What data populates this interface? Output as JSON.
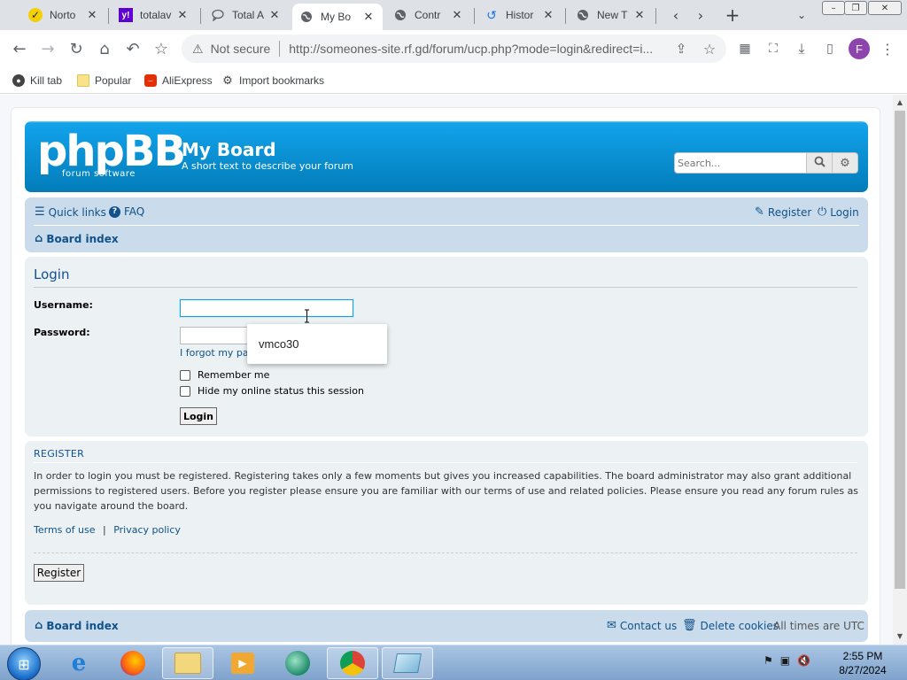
{
  "browser": {
    "tabs": [
      {
        "title": "Norto",
        "icon": "norton-icon",
        "active": false
      },
      {
        "title": "totalav",
        "icon": "yahoo-icon",
        "active": false
      },
      {
        "title": "Total A",
        "icon": "chat-bubble-icon",
        "active": false
      },
      {
        "title": "My Bo",
        "icon": "globe-icon",
        "active": true
      },
      {
        "title": "Contr",
        "icon": "globe-icon",
        "active": false
      },
      {
        "title": "Histor",
        "icon": "history-icon",
        "active": false
      },
      {
        "title": "New T",
        "icon": "globe-icon",
        "active": false
      }
    ],
    "omnibox": {
      "security_label": "Not secure",
      "url": "http://someones-site.rf.gd/forum/ucp.php?mode=login&redirect=i..."
    },
    "profile_initial": "F",
    "bookmarks": [
      {
        "label": "Kill tab",
        "icon": "kill-tab-icon"
      },
      {
        "label": "Popular",
        "icon": "folder-icon"
      },
      {
        "label": "AliExpress",
        "icon": "aliexpress-icon"
      },
      {
        "label": "Import bookmarks",
        "icon": "gear-icon"
      }
    ]
  },
  "forum": {
    "logo_text": "phpBB",
    "logo_subtext": "forum  software",
    "site_name": "My Board",
    "site_description": "A short text to describe your forum",
    "search_placeholder": "Search...",
    "nav": {
      "quick_links": "Quick links",
      "faq": "FAQ",
      "register": "Register",
      "login": "Login",
      "board_index": "Board index"
    },
    "login": {
      "title": "Login",
      "username_label": "Username:",
      "password_label": "Password:",
      "forgot_password": "I forgot my pa",
      "remember_me": "Remember me",
      "hide_status": "Hide my online status this session",
      "login_button": "Login",
      "autofill_suggestion": "vmco30"
    },
    "register": {
      "title": "REGISTER",
      "text": "In order to login you must be registered. Registering takes only a few moments but gives you increased capabilities. The board administrator may also grant additional permissions to registered users. Before you register please ensure you are familiar with our terms of use and related policies. Please ensure you read any forum rules as you navigate around the board.",
      "terms_link": "Terms of use",
      "separator": "|",
      "privacy_link": "Privacy policy",
      "register_button": "Register"
    },
    "footer": {
      "board_index": "Board index",
      "contact_us": "Contact us",
      "delete_cookies": "Delete cookies",
      "timezone": "All times are UTC"
    }
  },
  "taskbar": {
    "time": "2:55 PM",
    "date": "8/27/2024"
  }
}
